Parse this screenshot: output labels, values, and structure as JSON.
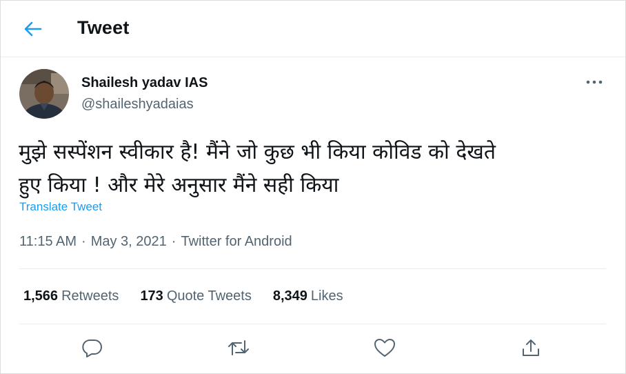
{
  "header": {
    "back_icon": "arrow-left-icon",
    "title": "Tweet",
    "accent_color": "#1d9bf0"
  },
  "author": {
    "display_name": "Shailesh yadav IAS",
    "handle": "@shaileshyadaias"
  },
  "tweet": {
    "text_line1": "मुझे सस्पेंशन स्वीकार है! मैंने जो कुछ भी किया कोविड को देखते",
    "text_line2": "हुए किया ! और मेरे अनुसार मैंने सही किया",
    "translate_label": "Translate Tweet",
    "time": "11:15 AM",
    "date": "May 3, 2021",
    "source": "Twitter for Android",
    "separator": "·"
  },
  "stats": {
    "retweets_count": "1,566",
    "retweets_label": "Retweets",
    "quotes_count": "173",
    "quotes_label": "Quote Tweets",
    "likes_count": "8,349",
    "likes_label": "Likes"
  },
  "actions": [
    "reply-icon",
    "retweet-icon",
    "like-icon",
    "share-icon"
  ]
}
